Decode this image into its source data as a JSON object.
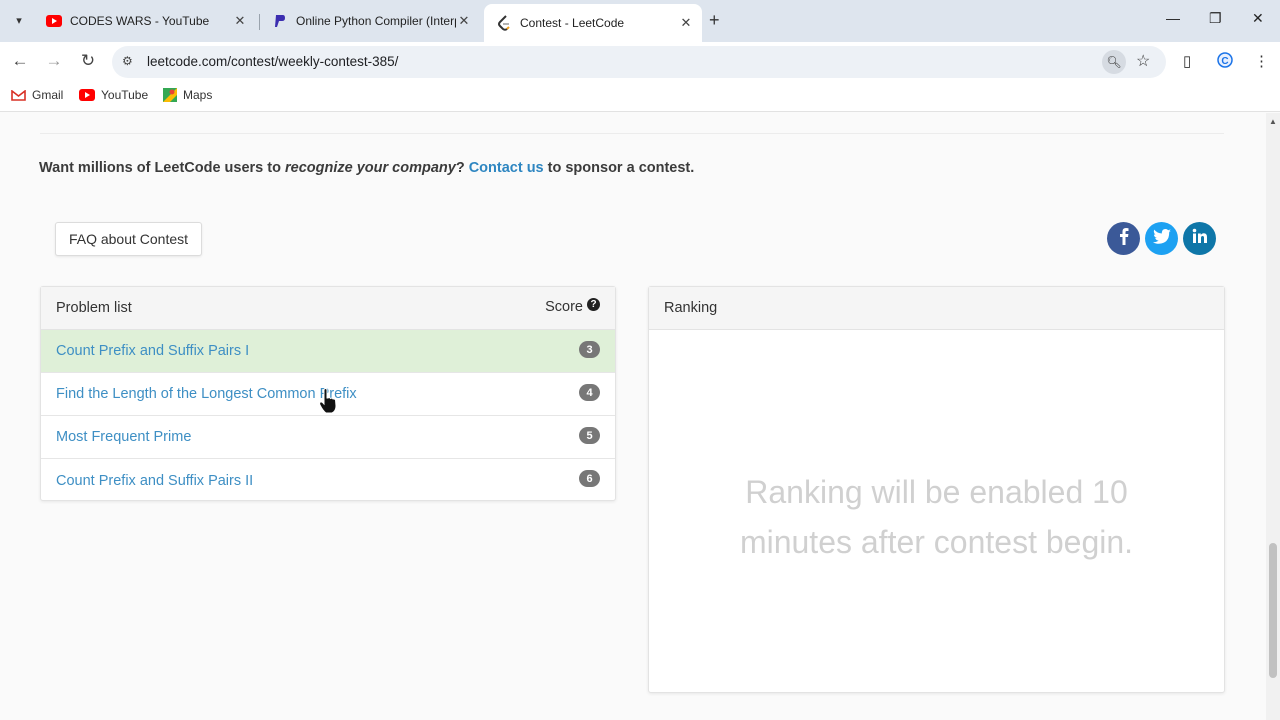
{
  "browser": {
    "tabs": [
      {
        "title": "CODES WARS - YouTube",
        "icon": "youtube-icon"
      },
      {
        "title": "Online Python Compiler (Interp",
        "icon": "programiz-icon"
      },
      {
        "title": "Contest - LeetCode",
        "icon": "leetcode-icon",
        "active": true
      }
    ],
    "url": "leetcode.com/contest/weekly-contest-385/",
    "bookmarks": [
      "Gmail",
      "YouTube",
      "Maps"
    ]
  },
  "page": {
    "sponsor": {
      "prefix": "Want millions of LeetCode users to ",
      "emphasis": "recognize your company",
      "middle": "? ",
      "link": "Contact us",
      "suffix": " to sponsor a contest."
    },
    "faq_label": "FAQ about Contest",
    "social": [
      {
        "name": "facebook",
        "glyph": "f",
        "color": "#3b5998"
      },
      {
        "name": "twitter",
        "glyph": "t",
        "color": "#1da1f2"
      },
      {
        "name": "linkedin",
        "glyph": "in",
        "color": "#0e76a8"
      }
    ],
    "problems": {
      "header": "Problem list",
      "score_label": "Score",
      "help_glyph": "?",
      "items": [
        {
          "title": "Count Prefix and Suffix Pairs I",
          "score": "3",
          "solved": true
        },
        {
          "title": "Find the Length of the Longest Common Prefix",
          "score": "4"
        },
        {
          "title": "Most Frequent Prime",
          "score": "5"
        },
        {
          "title": "Count Prefix and Suffix Pairs II",
          "score": "6"
        }
      ]
    },
    "ranking": {
      "header": "Ranking",
      "message_line1": "Ranking will be enabled 10",
      "message_line2": "minutes after contest begin."
    }
  },
  "colors": {
    "link": "#2e86c1",
    "solved_row": "#dff0d8",
    "badge": "#777777"
  }
}
